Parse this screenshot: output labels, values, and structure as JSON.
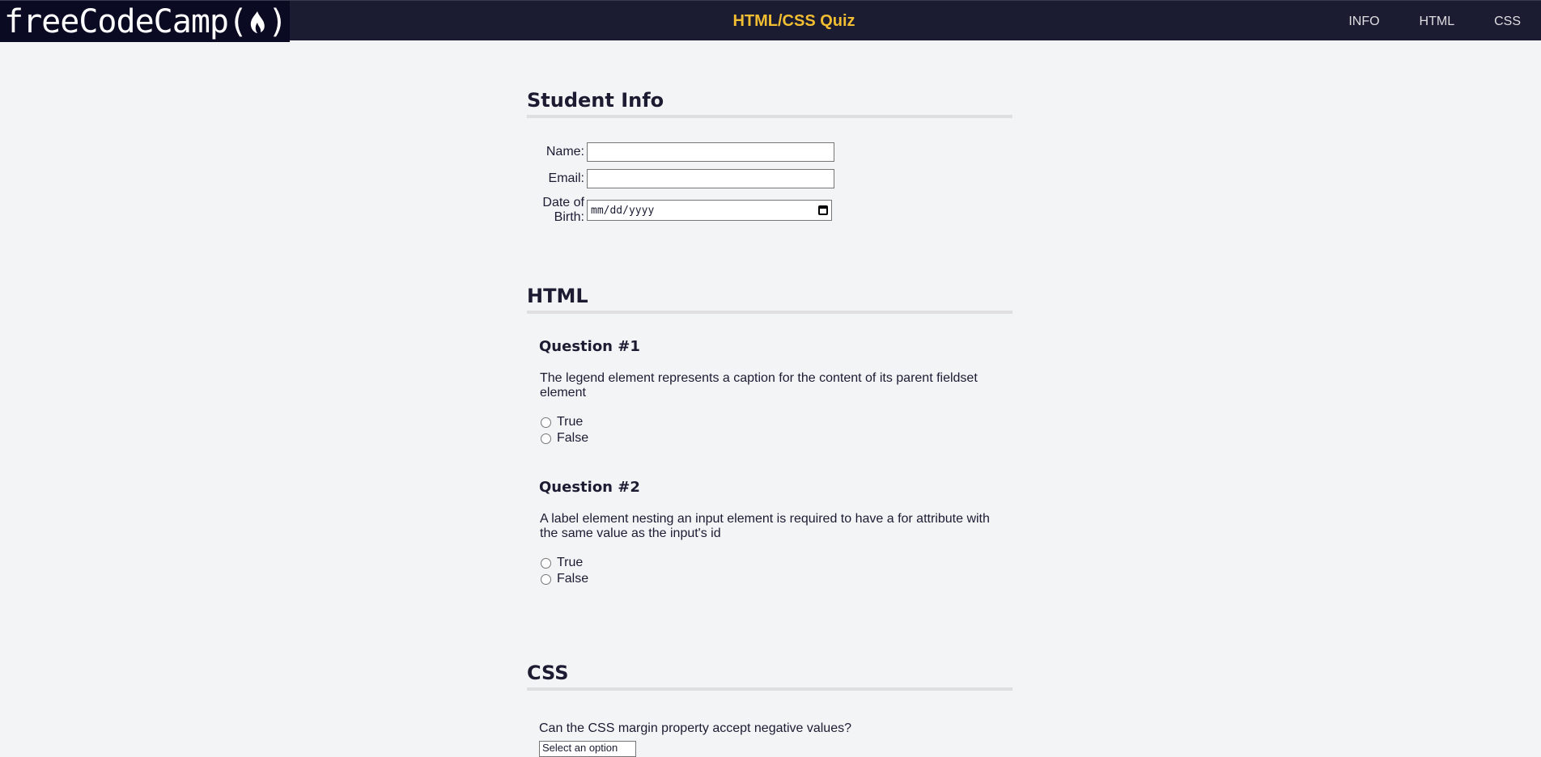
{
  "header": {
    "logo_text": "freeCodeCamp(",
    "logo_close": ")",
    "title": "HTML/CSS Quiz",
    "nav": [
      {
        "label": "INFO"
      },
      {
        "label": "HTML"
      },
      {
        "label": "CSS"
      }
    ]
  },
  "student_info": {
    "title": "Student Info",
    "name_label": "Name:",
    "email_label": "Email:",
    "dob_label_line1": "Date of",
    "dob_label_line2": "Birth:",
    "dob_placeholder": "mm/dd/yyyy"
  },
  "html_section": {
    "title": "HTML",
    "questions": [
      {
        "heading": "Question #1",
        "text": "The legend element represents a caption for the content of its parent fieldset element",
        "options": [
          "True",
          "False"
        ]
      },
      {
        "heading": "Question #2",
        "text": "A label element nesting an input element is required to have a for attribute with the same value as the input's id",
        "options": [
          "True",
          "False"
        ]
      }
    ]
  },
  "css_section": {
    "title": "CSS",
    "question_text": "Can the CSS margin property accept negative values?",
    "select_value": "Select an option"
  },
  "colors": {
    "header_bg": "#1b1b32",
    "logo_bg": "#0a0a23",
    "title_accent": "#f1be32",
    "page_bg": "#f3f4f6"
  },
  "icons": [
    "fcc-flame-icon",
    "calendar-icon"
  ]
}
